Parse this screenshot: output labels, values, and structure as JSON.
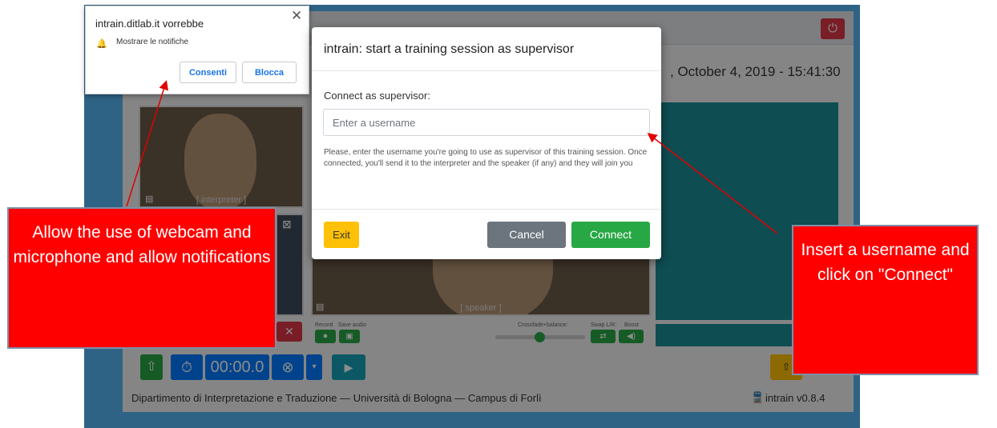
{
  "app": {
    "date_time": ", October 4, 2019 - 15:41:30",
    "footer": "Dipartimento di Interpretazione e Traduzione — Università di Bologna — Campus di Forlì",
    "version": "intrain v0.8.4",
    "timer": "00:00.0",
    "video_labels": {
      "interpreter": "[ interpreter ]",
      "speaker": "[ speaker ]"
    },
    "control_labels": {
      "record": "Record",
      "save_audio": "Save audio",
      "crossfade": "Crossfade+balance:",
      "swap": "Swap L/R:",
      "boost": "Boost"
    }
  },
  "notification": {
    "title": "intrain.ditlab.it vorrebbe",
    "message": "Mostrare le notifiche",
    "allow_label": "Consenti",
    "block_label": "Blocca",
    "close_glyph": "✕"
  },
  "modal": {
    "title": "intrain: start a training session as supervisor",
    "label": "Connect as supervisor:",
    "input_placeholder": "Enter a username",
    "input_value": "",
    "help_text": "Please, enter the username you're going to use as supervisor of this training session. Once connected, you'll send it to the interpreter and the speaker (if any) and they will join you",
    "exit_label": "Exit",
    "cancel_label": "Cancel",
    "connect_label": "Connect"
  },
  "callouts": {
    "left": "Allow the use of webcam and microphone and allow notifications",
    "right": "Insert a username and click on \"Connect\""
  },
  "colors": {
    "primary_blue": "#007bff",
    "success_green": "#28a745",
    "danger_red": "#dc3545",
    "warning_yellow": "#ffc107",
    "secondary_gray": "#6c757d",
    "teal": "#17a2b8",
    "callout_red": "#ff0000"
  },
  "icons": [
    "power-icon",
    "bell-icon",
    "close-icon",
    "file-upload-icon",
    "stopwatch-icon",
    "cancel-circle-icon",
    "caret-down-icon",
    "play-icon",
    "shuffle-icon",
    "volume-icon",
    "save-icon",
    "mic-off-icon",
    "cam-off-icon",
    "upload-icon",
    "train-icon"
  ]
}
